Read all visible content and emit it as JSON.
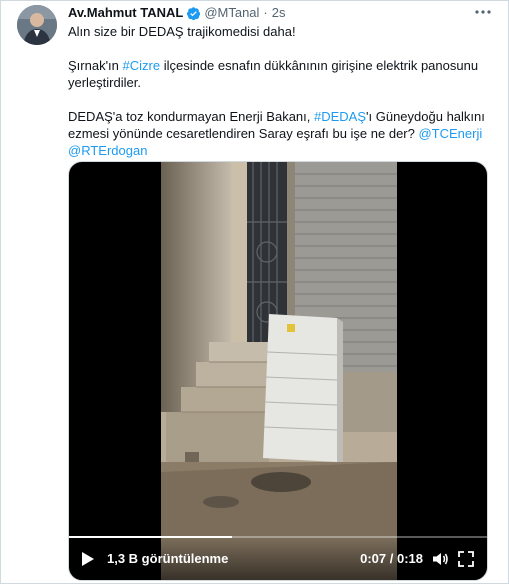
{
  "tweet": {
    "author_name": "Av.Mahmut TANAL",
    "handle": "@MTanal",
    "separator": "·",
    "time": "2s",
    "more_icon": "more-horizontal-icon",
    "paragraph1": "Alın size bir DEDAŞ trajikomedisi daha!",
    "p2_before": "Şırnak'ın ",
    "p2_tag": "#Cizre",
    "p2_after": " ilçesinde esnafın dükkânının girişine elektrik panosunu yerleştirdiler.",
    "p3_before": "DEDAŞ'a toz kondurmayan Enerji Bakanı, ",
    "p3_tag": "#DEDAŞ",
    "p3_after": "'ı Güneydoğu halkını ezmesi yönünde cesaretlendiren Saray eşrafı bu işe ne der? ",
    "p3_mention1": "@TCEnerji",
    "p3_space": " ",
    "p3_mention2": "@RTErdogan"
  },
  "video": {
    "views": "1,3 B görüntülenme",
    "time_readout": "0:07 / 0:18",
    "progress_fraction": 0.39,
    "play_icon": "play-icon",
    "volume_icon": "volume-icon",
    "fullscreen_icon": "fullscreen-icon"
  },
  "colors": {
    "link": "#1d9bf0",
    "secondary_text": "#536471",
    "verified_badge": "#1d9bf0"
  }
}
